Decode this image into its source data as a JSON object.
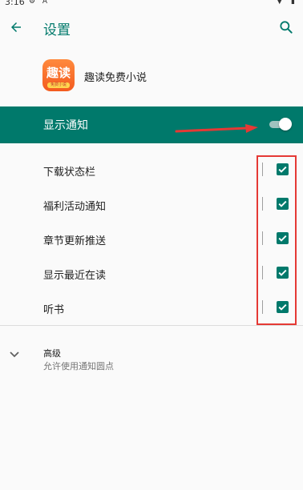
{
  "status_bar": {
    "time": "3:16",
    "left_icons": "⚙ A",
    "right_icons": "▼ ▮"
  },
  "toolbar": {
    "title": "设置",
    "back_icon": "arrow-back-icon",
    "search_icon": "search-icon"
  },
  "app": {
    "name": "趣读免费小说",
    "icon_text": "趣读",
    "icon_subtext": "免费小说"
  },
  "master": {
    "label": "显示通知",
    "enabled": true
  },
  "channels": [
    {
      "label": "下载状态栏",
      "checked": true
    },
    {
      "label": "福利活动通知",
      "checked": true
    },
    {
      "label": "章节更新推送",
      "checked": true
    },
    {
      "label": "显示最近在读",
      "checked": true
    },
    {
      "label": "听书",
      "checked": true
    }
  ],
  "advanced": {
    "title": "高级",
    "subtitle": "允许使用通知圆点"
  },
  "colors": {
    "accent": "#00796b",
    "annotation": "#e53935"
  }
}
